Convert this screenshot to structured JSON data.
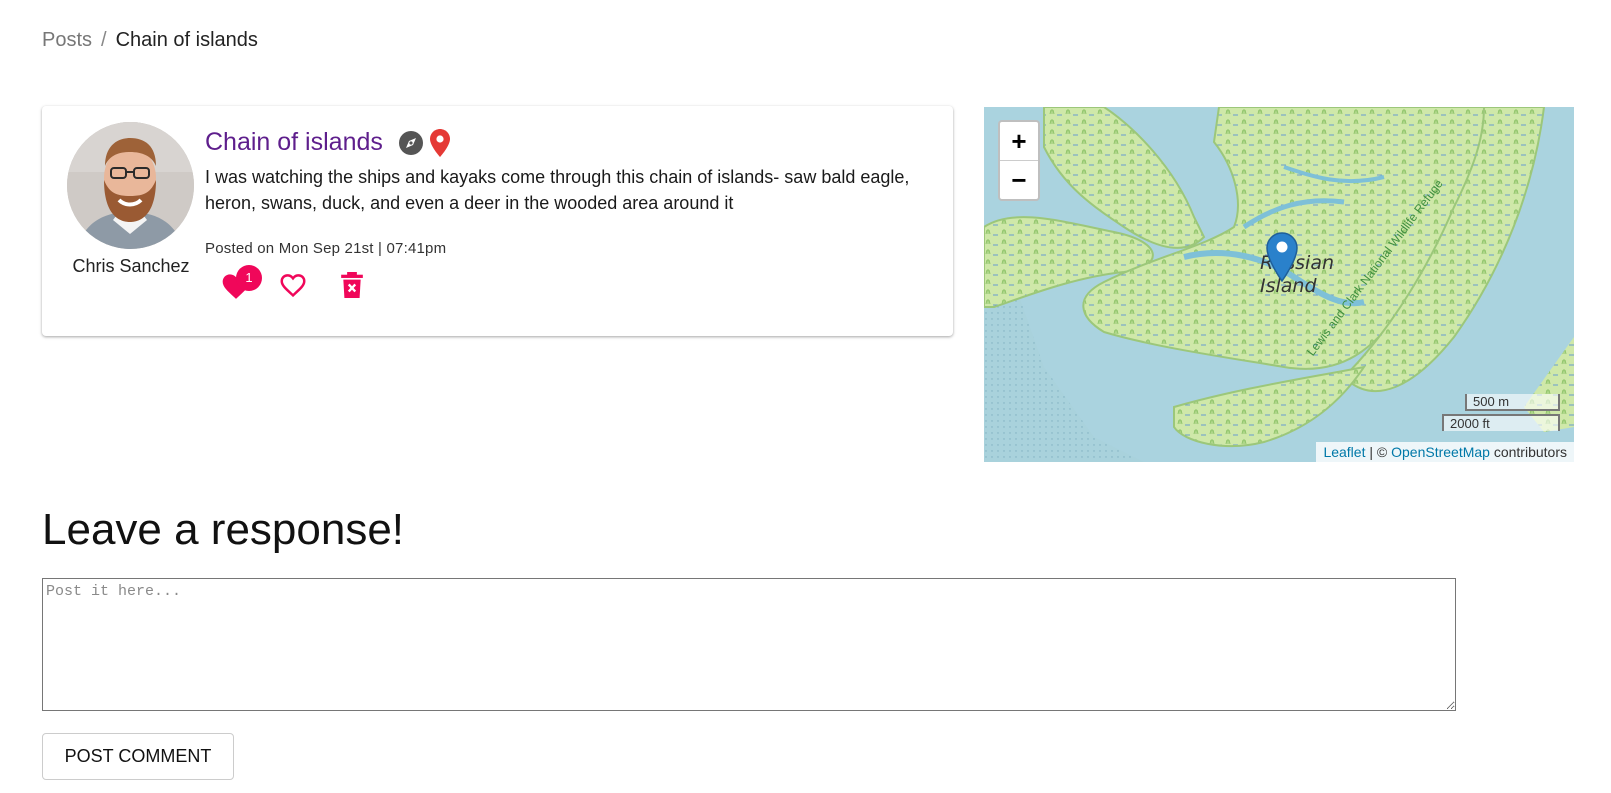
{
  "breadcrumb": {
    "root": "Posts",
    "separator": "/",
    "current": "Chain of islands"
  },
  "post": {
    "author": "Chris Sanchez",
    "title": "Chain of islands",
    "title_icons": [
      "compass-icon",
      "map-pin-icon"
    ],
    "body": "I was watching the ships and kayaks come through this chain of islands- saw bald eagle, heron, swans, duck, and even a deer in the wooded area around it",
    "meta": "Posted on Mon Sep 21st | 07:41pm",
    "like_count": "1",
    "colors": {
      "title": "#5e1e8c",
      "accent": "#f0075a"
    }
  },
  "map": {
    "zoom_in": "+",
    "zoom_out": "−",
    "place_label_line1": "Russian",
    "place_label_line2": "Island",
    "refuge_label": "Lewis and Clark National Wildlife Refuge",
    "scale_metric": "500 m",
    "scale_imperial": "2000 ft",
    "attribution": {
      "leaflet": "Leaflet",
      "sep": " | © ",
      "osm": "OpenStreetMap",
      "suffix": " contributors"
    },
    "colors": {
      "water": "#aad3df",
      "land": "#cde8a8",
      "marker": "#2a81cb"
    }
  },
  "response": {
    "heading": "Leave a response!",
    "placeholder": "Post it here...",
    "button_label": "POST COMMENT"
  }
}
